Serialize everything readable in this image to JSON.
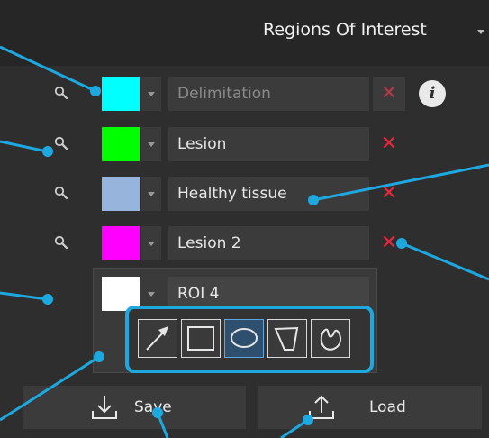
{
  "header": {
    "title": "Regions Of Interest",
    "menu_icon": "chevron-down-icon"
  },
  "rois": [
    {
      "label": "Delimitation",
      "color": "#00ffff",
      "disabled": true
    },
    {
      "label": "Lesion",
      "color": "#00ff00",
      "disabled": false
    },
    {
      "label": "Healthy tissue",
      "color": "#96b4dc",
      "disabled": false
    },
    {
      "label": "Lesion 2",
      "color": "#ff00ff",
      "disabled": false
    },
    {
      "label": "ROI 4",
      "color": "#ffffff",
      "disabled": false
    }
  ],
  "delete_symbol": "✕",
  "info_symbol": "i",
  "tools": [
    {
      "name": "arrow-tool-icon",
      "selected": false
    },
    {
      "name": "rectangle-tool-icon",
      "selected": false
    },
    {
      "name": "ellipse-tool-icon",
      "selected": true
    },
    {
      "name": "polygon-tool-icon",
      "selected": false
    },
    {
      "name": "freehand-tool-icon",
      "selected": false
    }
  ],
  "actions": {
    "save_label": "Save",
    "load_label": "Load"
  },
  "colors": {
    "callout": "#1ea8e0",
    "delete": "#e8283c"
  }
}
